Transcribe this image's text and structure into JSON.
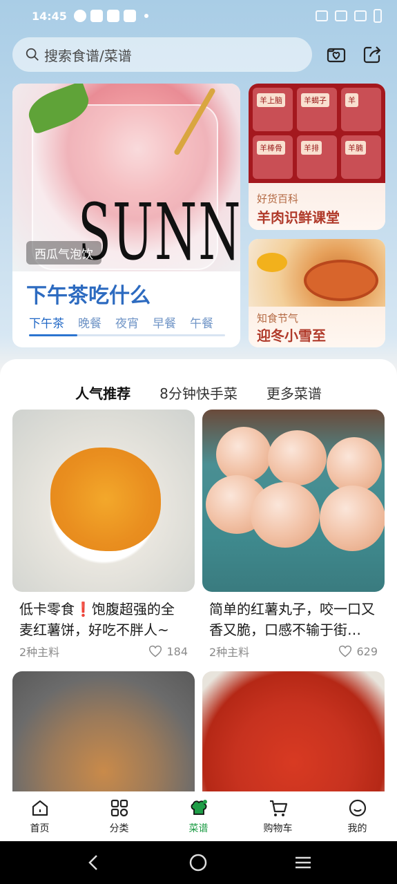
{
  "status_bar": {
    "time": "14:45"
  },
  "search": {
    "placeholder": "搜索食谱/菜谱"
  },
  "hero": {
    "image_tag": "西瓜气泡饮",
    "title": "下午茶吃什么",
    "tabs": [
      "下午茶",
      "晚餐",
      "夜宵",
      "早餐",
      "午餐"
    ],
    "active_tab": 0,
    "image_text": "SUNNY"
  },
  "side_cards": [
    {
      "subtitle": "好货百科",
      "title": "羊肉识鲜课堂",
      "cells": [
        "羊上脑",
        "羊蝎子",
        "羊",
        "羊棒骨",
        "羊排",
        "羊腩"
      ]
    },
    {
      "subtitle": "知食节气",
      "title": "迎冬小雪至"
    }
  ],
  "category_tabs": [
    "人气推荐",
    "8分钟快手菜",
    "更多菜谱"
  ],
  "active_category": 0,
  "recipes": [
    {
      "title": "低卡零食❗饱腹超强的全麦红薯饼，好吃不胖人~",
      "ingredients": "2种主料",
      "likes": "184"
    },
    {
      "title": "简单的红薯丸子，咬一口又香又脆，口感不输于街…",
      "ingredients": "2种主料",
      "likes": "629"
    },
    {
      "title": "",
      "ingredients": "",
      "likes": ""
    },
    {
      "title": "",
      "ingredients": "",
      "likes": ""
    }
  ],
  "tabbar": {
    "items": [
      {
        "label": "首页",
        "icon": "home-icon"
      },
      {
        "label": "分类",
        "icon": "grid-icon"
      },
      {
        "label": "菜谱",
        "icon": "chef-hat-icon"
      },
      {
        "label": "购物车",
        "icon": "cart-icon"
      },
      {
        "label": "我的",
        "icon": "smile-icon"
      }
    ],
    "active": 2
  },
  "colors": {
    "accent_green": "#1f9d47",
    "hero_blue": "#2d6bc0",
    "highlight_green": "#2fd16a"
  }
}
